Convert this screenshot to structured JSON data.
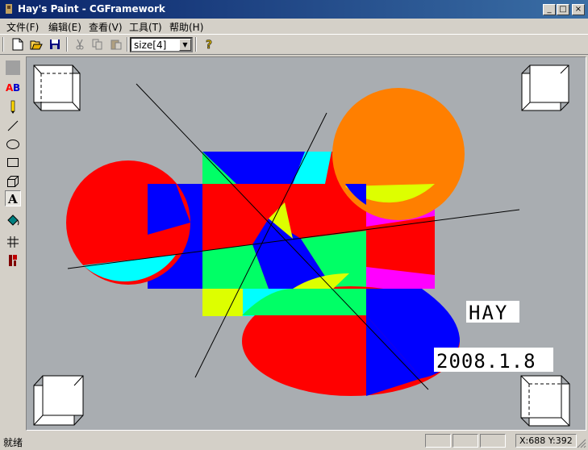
{
  "window": {
    "title": "Hay's Paint - CGFramework",
    "icon": "paint-app-icon",
    "buttons": [
      "minimize",
      "maximize",
      "close"
    ]
  },
  "menu": [
    {
      "label": "文件(F)"
    },
    {
      "label": "编辑(E)"
    },
    {
      "label": "查看(V)"
    },
    {
      "label": "工具(T)"
    },
    {
      "label": "帮助(H)"
    }
  ],
  "toolbar": {
    "buttons": [
      "new-icon",
      "open-icon",
      "save-icon",
      "cut-icon",
      "copy-icon",
      "paste-icon",
      "help-icon"
    ],
    "size_value": "size[4]"
  },
  "tools": [
    "select-tool",
    "text-ab-tool",
    "pencil-tool",
    "line-tool",
    "ellipse-tool",
    "rectangle-tool",
    "cube-tool",
    "text-a-tool",
    "fill-tool",
    "grid-tool",
    "brush-tool"
  ],
  "canvas": {
    "background": "#a9adb1",
    "text_hay": "HAY",
    "text_date": "2008.1.8"
  },
  "status": {
    "ready": "就绪",
    "coords": "X:688 Y:392"
  },
  "colors": {
    "red": "#ff0000",
    "blue": "#0000ff",
    "cyan": "#00ffff",
    "green": "#00ff66",
    "yellow": "#ddff00",
    "magenta": "#ff00ff",
    "orange": "#ff7f00"
  }
}
